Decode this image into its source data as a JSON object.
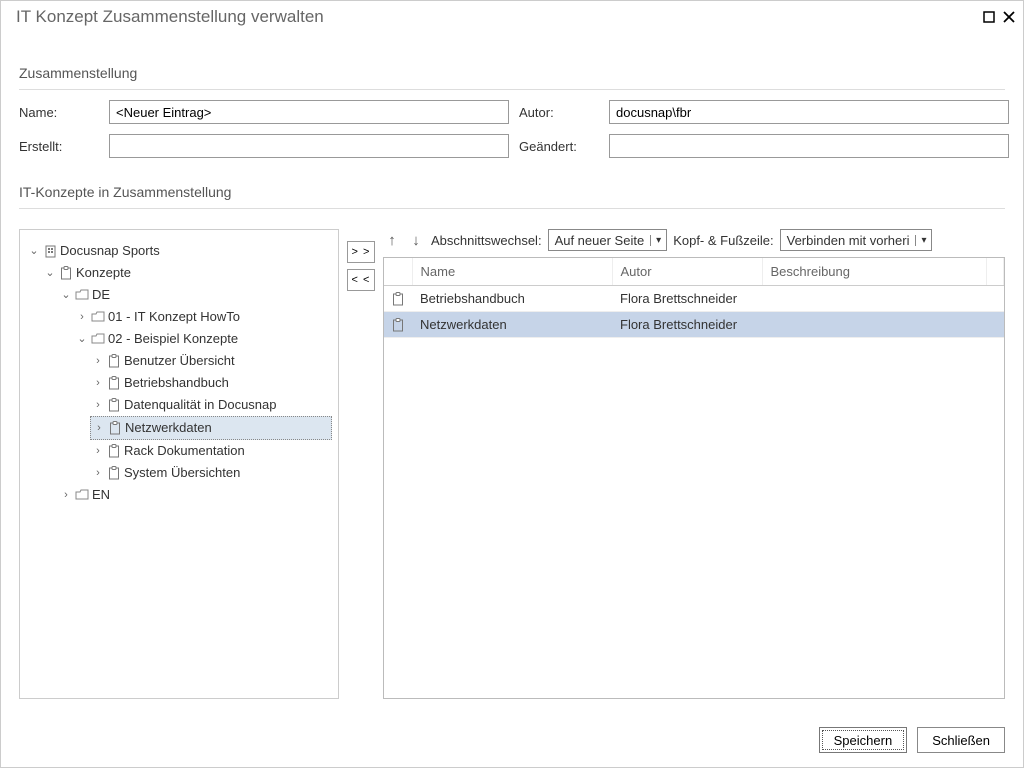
{
  "window": {
    "title": "IT Konzept Zusammenstellung verwalten"
  },
  "section1": {
    "label": "Zusammenstellung"
  },
  "form": {
    "name_label": "Name:",
    "name_value": "<Neuer Eintrag>",
    "author_label": "Autor:",
    "author_value": "docusnap\\fbr",
    "created_label": "Erstellt:",
    "created_value": "",
    "modified_label": "Geändert:",
    "modified_value": ""
  },
  "section2": {
    "label": "IT-Konzepte in Zusammenstellung"
  },
  "tree": {
    "root": "Docusnap Sports",
    "concepts": "Konzepte",
    "de": "DE",
    "en": "EN",
    "folder01": "01 - IT Konzept HowTo",
    "folder02": "02 - Beispiel Konzepte",
    "items": [
      "Benutzer Übersicht",
      "Betriebshandbuch",
      "Datenqualität in Docusnap",
      "Netzwerkdaten",
      "Rack Dokumentation",
      "System Übersichten"
    ]
  },
  "transfer": {
    "add": "> >",
    "remove": "< <"
  },
  "toolbar": {
    "section_label": "Abschnittswechsel:",
    "section_value": "Auf neuer Seite",
    "header_label": "Kopf- & Fußzeile:",
    "header_value": "Verbinden mit vorheri"
  },
  "grid": {
    "col_name": "Name",
    "col_author": "Autor",
    "col_desc": "Beschreibung",
    "rows": [
      {
        "name": "Betriebshandbuch",
        "author": "Flora Brettschneider",
        "desc": ""
      },
      {
        "name": "Netzwerkdaten",
        "author": "Flora Brettschneider",
        "desc": ""
      }
    ]
  },
  "footer": {
    "save": "Speichern",
    "close": "Schließen"
  }
}
